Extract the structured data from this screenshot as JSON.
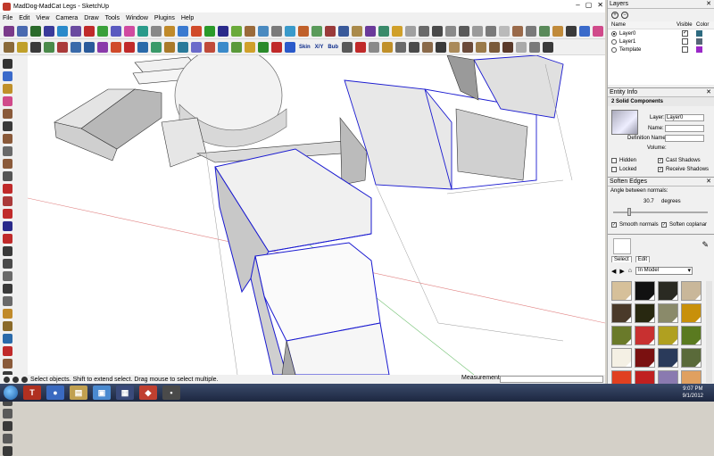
{
  "window": {
    "title": "MadDog-MadCat Legs - SketchUp"
  },
  "menu": [
    "File",
    "Edit",
    "View",
    "Camera",
    "Draw",
    "Tools",
    "Window",
    "Plugins",
    "Help"
  ],
  "toolbar": {
    "plugin_labels": [
      "Skin",
      "X/Y",
      "Bub"
    ]
  },
  "layers_panel": {
    "title": "Layers",
    "col_name": "Name",
    "col_visible": "Visible",
    "col_color": "Color",
    "layers": [
      {
        "name": "Layer0",
        "active": true,
        "visible": true,
        "color": "#2e6b80"
      },
      {
        "name": "Layer1",
        "active": false,
        "visible": false,
        "color": "#556677"
      },
      {
        "name": "Template",
        "active": false,
        "visible": false,
        "color": "#9a28c8"
      }
    ]
  },
  "entity_info": {
    "title": "Entity Info",
    "header": "2 Solid Components",
    "layer_label": "Layer:",
    "layer_value": "Layer0",
    "name_label": "Name:",
    "definition_label": "Definition Name:",
    "volume_label": "Volume:",
    "hidden_label": "Hidden",
    "locked_label": "Locked",
    "cast_label": "Cast Shadows",
    "receive_label": "Receive Shadows",
    "hidden": false,
    "locked": false,
    "cast": true,
    "receive": true
  },
  "soften_edges": {
    "title": "Soften Edges",
    "angle_label": "Angle between normals:",
    "angle_value": "30.7",
    "angle_unit": "degrees",
    "smooth_label": "Smooth normals",
    "coplanar_label": "Soften coplanar"
  },
  "materials": {
    "tab_select": "Select",
    "tab_edit": "Edit",
    "collection": "In Model",
    "swatches": [
      "#d6c09a",
      "#111111",
      "#2a2a22",
      "#c9b79a",
      "#4a3a2a",
      "#282810",
      "#8a8a6a",
      "#c8900a",
      "#6a7a2a",
      "#c83030",
      "#b0a020",
      "#5a7a20",
      "#f4f0e4",
      "#7a1010",
      "#2a3a5a",
      "#5a6a3a",
      "#e04020",
      "#c02020",
      "#8a7ab0",
      "#e0a060"
    ]
  },
  "status": {
    "hint": "Select objects. Shift to extend select. Drag mouse to select multiple.",
    "measurements_label": "Measurements"
  },
  "taskbar": {
    "time": "9:07 PM",
    "date": "9/1/2012"
  }
}
